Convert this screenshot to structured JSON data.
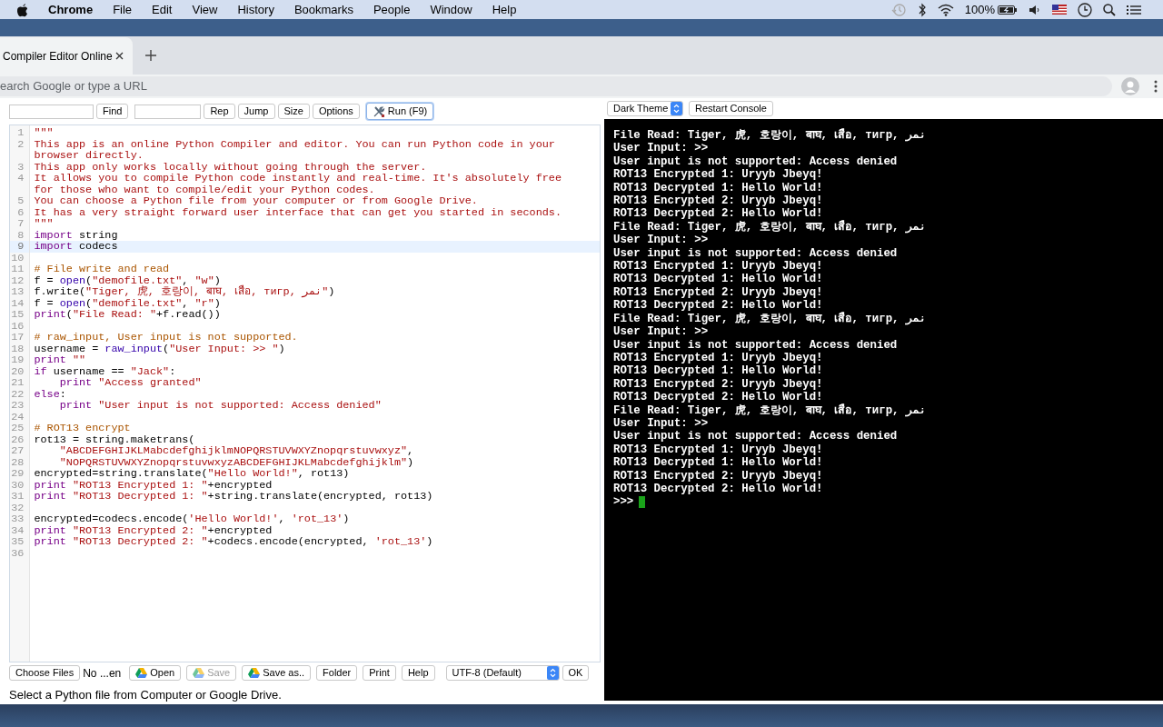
{
  "menubar": {
    "app": "Chrome",
    "menus": [
      "File",
      "Edit",
      "View",
      "History",
      "Bookmarks",
      "People",
      "Window",
      "Help"
    ],
    "battery_text": "100%"
  },
  "browser": {
    "tab_title": "Compiler Editor Online",
    "address_placeholder": "earch Google or type a URL"
  },
  "toolbar": [
    {
      "kind": "field"
    },
    {
      "kind": "button",
      "label": "Find",
      "focused": false
    },
    {
      "kind": "field"
    },
    {
      "kind": "button",
      "label": "Rep",
      "focused": false
    },
    {
      "kind": "button",
      "label": "Jump",
      "focused": false
    },
    {
      "kind": "button",
      "label": "Size",
      "focused": false
    },
    {
      "kind": "button",
      "label": "Options",
      "focused": false
    },
    {
      "kind": "run",
      "label": "Run (F9)",
      "focused": true
    }
  ],
  "editor": {
    "lines": [
      {
        "number": "1",
        "active": false,
        "tokens": [
          {
            "kind": "str",
            "text": "\"\"\""
          }
        ]
      },
      {
        "number": "2",
        "active": false,
        "tokens": [
          {
            "kind": "str",
            "text": "This app is an online Python Compiler and editor. You can run Python code in your browser directly."
          }
        ]
      },
      {
        "number": "3",
        "active": false,
        "tokens": [
          {
            "kind": "str",
            "text": "This app only works locally without going through the server."
          }
        ]
      },
      {
        "number": "4",
        "active": false,
        "tokens": [
          {
            "kind": "str",
            "text": "It allows you to compile Python code instantly and real-time. It's absolutely free for those who want to compile/edit your Python codes."
          }
        ]
      },
      {
        "number": "5",
        "active": false,
        "tokens": [
          {
            "kind": "str",
            "text": "You can choose a Python file from your computer or from Google Drive."
          }
        ]
      },
      {
        "number": "6",
        "active": false,
        "tokens": [
          {
            "kind": "str",
            "text": "It has a very straight forward user interface that can get you started in seconds."
          }
        ]
      },
      {
        "number": "7",
        "active": false,
        "tokens": [
          {
            "kind": "str",
            "text": "\"\"\""
          }
        ]
      },
      {
        "number": "8",
        "active": false,
        "tokens": [
          {
            "kind": "kw",
            "text": "import"
          },
          {
            "kind": "plain",
            "text": " string"
          }
        ]
      },
      {
        "number": "9",
        "active": true,
        "tokens": [
          {
            "kind": "kw",
            "text": "import"
          },
          {
            "kind": "plain",
            "text": " codecs"
          }
        ]
      },
      {
        "number": "10",
        "active": false
      },
      {
        "number": "11",
        "active": false,
        "tokens": [
          {
            "kind": "comment",
            "text": "# File write and read"
          }
        ]
      },
      {
        "number": "12",
        "active": false,
        "tokens": [
          {
            "kind": "plain",
            "text": "f = "
          },
          {
            "kind": "builtin",
            "text": "open"
          },
          {
            "kind": "plain",
            "text": "("
          },
          {
            "kind": "str",
            "text": "\"demofile.txt\""
          },
          {
            "kind": "plain",
            "text": ", "
          },
          {
            "kind": "str",
            "text": "\"w\""
          },
          {
            "kind": "plain",
            "text": ")"
          }
        ]
      },
      {
        "number": "13",
        "active": false,
        "tokens": [
          {
            "kind": "plain",
            "text": "f.write("
          },
          {
            "kind": "str",
            "text": "\"Tiger, 虎, 호랑이, बाघ, เสือ, тигр, نمر\""
          },
          {
            "kind": "plain",
            "text": ")"
          }
        ]
      },
      {
        "number": "14",
        "active": false,
        "tokens": [
          {
            "kind": "plain",
            "text": "f = "
          },
          {
            "kind": "builtin",
            "text": "open"
          },
          {
            "kind": "plain",
            "text": "("
          },
          {
            "kind": "str",
            "text": "\"demofile.txt\""
          },
          {
            "kind": "plain",
            "text": ", "
          },
          {
            "kind": "str",
            "text": "\"r\""
          },
          {
            "kind": "plain",
            "text": ")"
          }
        ]
      },
      {
        "number": "15",
        "active": false,
        "tokens": [
          {
            "kind": "kw",
            "text": "print"
          },
          {
            "kind": "plain",
            "text": "("
          },
          {
            "kind": "str",
            "text": "\"File Read: \""
          },
          {
            "kind": "plain",
            "text": "+f.read())"
          }
        ]
      },
      {
        "number": "16",
        "active": false
      },
      {
        "number": "17",
        "active": false,
        "tokens": [
          {
            "kind": "comment",
            "text": "# raw_input, User input is not supported."
          }
        ]
      },
      {
        "number": "18",
        "active": false,
        "tokens": [
          {
            "kind": "plain",
            "text": "username = "
          },
          {
            "kind": "builtin",
            "text": "raw_input"
          },
          {
            "kind": "plain",
            "text": "("
          },
          {
            "kind": "str",
            "text": "\"User Input: >> \""
          },
          {
            "kind": "plain",
            "text": ")"
          }
        ]
      },
      {
        "number": "19",
        "active": false,
        "tokens": [
          {
            "kind": "kw",
            "text": "print"
          },
          {
            "kind": "str",
            "text": " \"\""
          }
        ]
      },
      {
        "number": "20",
        "active": false,
        "tokens": [
          {
            "kind": "kw",
            "text": "if"
          },
          {
            "kind": "plain",
            "text": " username == "
          },
          {
            "kind": "str",
            "text": "\"Jack\""
          },
          {
            "kind": "plain",
            "text": ":"
          }
        ]
      },
      {
        "number": "21",
        "active": false,
        "tokens": [
          {
            "kind": "kw",
            "text": "    print"
          },
          {
            "kind": "str",
            "text": " \"Access granted\""
          }
        ]
      },
      {
        "number": "22",
        "active": false,
        "tokens": [
          {
            "kind": "kw",
            "text": "else"
          },
          {
            "kind": "plain",
            "text": ":"
          }
        ]
      },
      {
        "number": "23",
        "active": false,
        "tokens": [
          {
            "kind": "kw",
            "text": "    print"
          },
          {
            "kind": "str",
            "text": " \"User input is not supported: Access denied\""
          }
        ]
      },
      {
        "number": "24",
        "active": false
      },
      {
        "number": "25",
        "active": false,
        "tokens": [
          {
            "kind": "comment",
            "text": "# ROT13 encrypt"
          }
        ]
      },
      {
        "number": "26",
        "active": false,
        "tokens": [
          {
            "kind": "plain",
            "text": "rot13 = string.maketrans("
          }
        ]
      },
      {
        "number": "27",
        "active": false,
        "tokens": [
          {
            "kind": "str",
            "text": "    \"ABCDEFGHIJKLMabcdefghijklmNOPQRSTUVWXYZnopqrstuvwxyz\""
          },
          {
            "kind": "plain",
            "text": ","
          }
        ]
      },
      {
        "number": "28",
        "active": false,
        "tokens": [
          {
            "kind": "str",
            "text": "    \"NOPQRSTUVWXYZnopqrstuvwxyzABCDEFGHIJKLMabcdefghijklm\""
          },
          {
            "kind": "plain",
            "text": ")"
          }
        ]
      },
      {
        "number": "29",
        "active": false,
        "tokens": [
          {
            "kind": "plain",
            "text": "encrypted=string.translate("
          },
          {
            "kind": "str",
            "text": "\"Hello World!\""
          },
          {
            "kind": "plain",
            "text": ", rot13)"
          }
        ]
      },
      {
        "number": "30",
        "active": false,
        "tokens": [
          {
            "kind": "kw",
            "text": "print"
          },
          {
            "kind": "str",
            "text": " \"ROT13 Encrypted 1: \""
          },
          {
            "kind": "plain",
            "text": "+encrypted"
          }
        ]
      },
      {
        "number": "31",
        "active": false,
        "tokens": [
          {
            "kind": "kw",
            "text": "print"
          },
          {
            "kind": "str",
            "text": " \"ROT13 Decrypted 1: \""
          },
          {
            "kind": "plain",
            "text": "+string.translate(encrypted, rot13)"
          }
        ]
      },
      {
        "number": "32",
        "active": false
      },
      {
        "number": "33",
        "active": false,
        "tokens": [
          {
            "kind": "plain",
            "text": "encrypted=codecs.encode("
          },
          {
            "kind": "str",
            "text": "'Hello World!'"
          },
          {
            "kind": "plain",
            "text": ", "
          },
          {
            "kind": "str",
            "text": "'rot_13'"
          },
          {
            "kind": "plain",
            "text": ")"
          }
        ]
      },
      {
        "number": "34",
        "active": false,
        "tokens": [
          {
            "kind": "kw",
            "text": "print"
          },
          {
            "kind": "str",
            "text": " \"ROT13 Encrypted 2: \""
          },
          {
            "kind": "plain",
            "text": "+encrypted"
          }
        ]
      },
      {
        "number": "35",
        "active": false,
        "tokens": [
          {
            "kind": "kw",
            "text": "print"
          },
          {
            "kind": "str",
            "text": " \"ROT13 Decrypted 2: \""
          },
          {
            "kind": "plain",
            "text": "+codecs.encode(encrypted, "
          },
          {
            "kind": "str",
            "text": "'rot_13'"
          },
          {
            "kind": "plain",
            "text": ")"
          }
        ]
      },
      {
        "number": "36",
        "active": false
      }
    ]
  },
  "file_bar": {
    "choose_button": "Choose Files",
    "file_name": "No ...en",
    "buttons": [
      {
        "kind": "drive",
        "label": "Open",
        "disabled": false
      },
      {
        "kind": "drive",
        "label": "Save",
        "disabled": true
      },
      {
        "kind": "drive",
        "label": "Save as..",
        "disabled": false
      },
      {
        "kind": "plain",
        "label": "Folder",
        "disabled": false
      },
      {
        "kind": "plain",
        "label": "Print",
        "disabled": false
      },
      {
        "kind": "plain",
        "label": "Help",
        "disabled": false
      }
    ],
    "encoding": "UTF-8 (Default)",
    "ok_button": "OK"
  },
  "status": "Select a Python file from Computer or Google Drive.",
  "console_controls": {
    "theme": "Dark Theme",
    "restart_button": "Restart Console"
  },
  "console": {
    "lines": [
      "File Read: Tiger, 虎, 호랑이, बाघ, เสือ, тигр, نمر",
      "User Input: >>",
      "User input is not supported: Access denied",
      "ROT13 Encrypted 1: Uryyb Jbeyq!",
      "ROT13 Decrypted 1: Hello World!",
      "ROT13 Encrypted 2: Uryyb Jbeyq!",
      "ROT13 Decrypted 2: Hello World!",
      "File Read: Tiger, 虎, 호랑이, बाघ, เสือ, тигр, نمر",
      "User Input: >>",
      "User input is not supported: Access denied",
      "ROT13 Encrypted 1: Uryyb Jbeyq!",
      "ROT13 Decrypted 1: Hello World!",
      "ROT13 Encrypted 2: Uryyb Jbeyq!",
      "ROT13 Decrypted 2: Hello World!",
      "File Read: Tiger, 虎, 호랑이, बाघ, เสือ, тигр, نمر",
      "User Input: >>",
      "User input is not supported: Access denied",
      "ROT13 Encrypted 1: Uryyb Jbeyq!",
      "ROT13 Decrypted 1: Hello World!",
      "ROT13 Encrypted 2: Uryyb Jbeyq!",
      "ROT13 Decrypted 2: Hello World!",
      "File Read: Tiger, 虎, 호랑이, बाघ, เสือ, тигр, نمر",
      "User Input: >>",
      "User input is not supported: Access denied",
      "ROT13 Encrypted 1: Uryyb Jbeyq!",
      "ROT13 Decrypted 1: Hello World!",
      "ROT13 Encrypted 2: Uryyb Jbeyq!",
      "ROT13 Decrypted 2: Hello World!"
    ],
    "prompt": ">>>"
  }
}
